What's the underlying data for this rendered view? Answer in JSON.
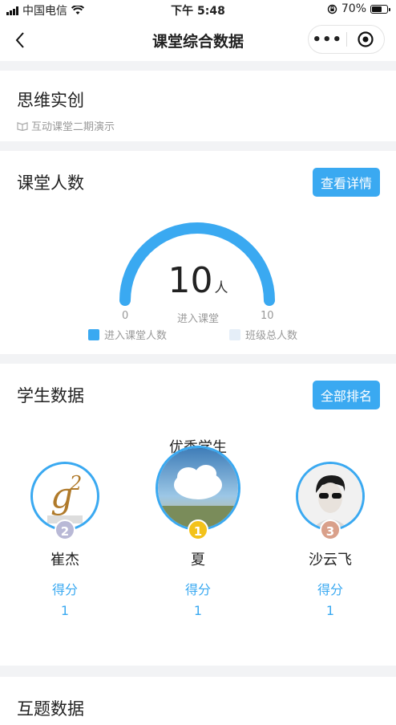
{
  "status": {
    "carrier": "中国电信",
    "time": "下午 5:48",
    "battery": "70%"
  },
  "nav": {
    "title": "课堂综合数据"
  },
  "course": {
    "name": "思维实创",
    "subtitle": "互动课堂二期演示"
  },
  "attendance": {
    "title": "课堂人数",
    "button": "查看详情",
    "value": "10",
    "unit": "人",
    "min_label": "0",
    "center_label": "进入课堂",
    "max_label": "10",
    "legend": [
      {
        "label": "进入课堂人数",
        "color": "#3aa9f1"
      },
      {
        "label": "班级总人数",
        "color": "#e5eef8"
      }
    ]
  },
  "students": {
    "title": "学生数据",
    "button": "全部排名",
    "subtitle": "优秀学生",
    "items": [
      {
        "rank": "2",
        "name": "崔杰",
        "score_label": "得分",
        "score": "1"
      },
      {
        "rank": "1",
        "name": "夏",
        "score_label": "得分",
        "score": "1"
      },
      {
        "rank": "3",
        "name": "沙云飞",
        "score_label": "得分",
        "score": "1"
      }
    ]
  },
  "next_section": {
    "title": "互题数据"
  }
}
